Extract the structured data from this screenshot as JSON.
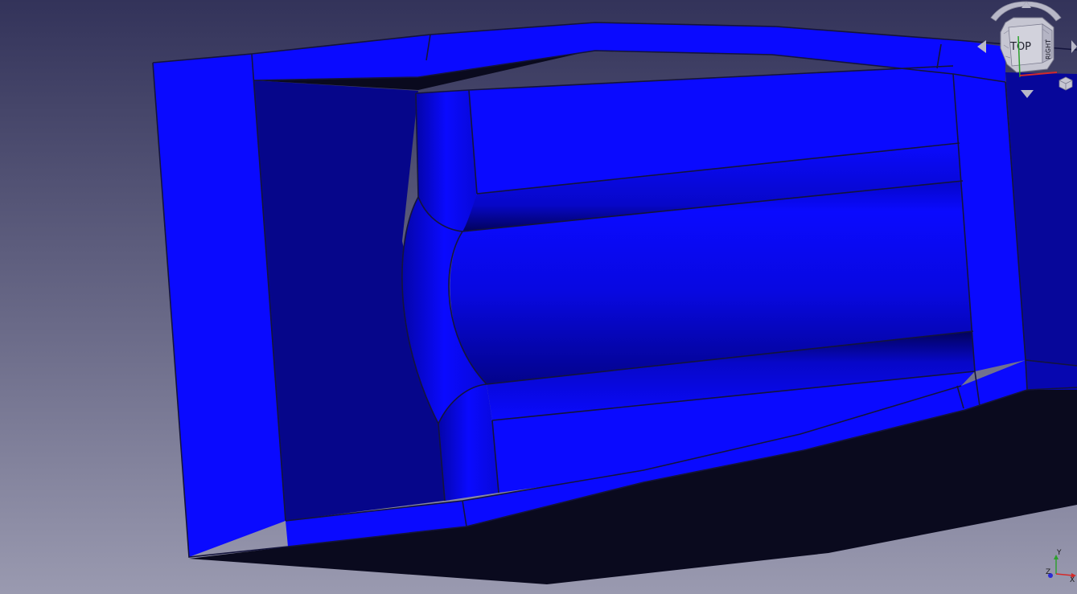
{
  "navigation_cube": {
    "front_face_label": "TOP",
    "side_face_label": "RIGHT"
  },
  "axis_triad": {
    "x_label": "X",
    "y_label": "Y",
    "z_label": "Z",
    "x_color": "#d42a2a",
    "y_color": "#2aa02a",
    "z_color": "#2a2ad4"
  },
  "model": {
    "face_color": "#0a0aff",
    "shadow_color": "#0a0a1e",
    "edge_color": "#14143c"
  }
}
